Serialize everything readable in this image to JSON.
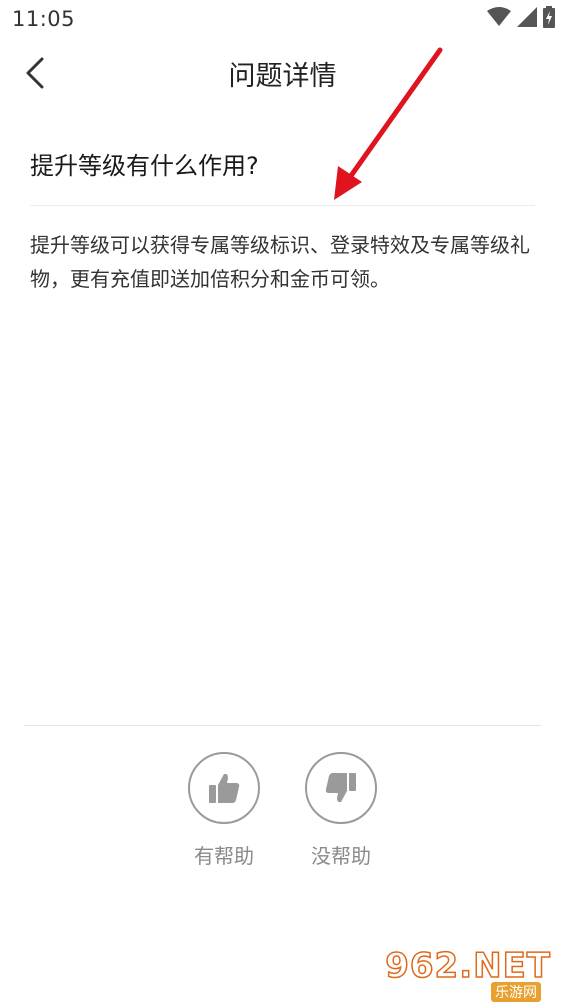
{
  "status_bar": {
    "time": "11:05"
  },
  "nav": {
    "title": "问题详情"
  },
  "question": {
    "title": "提升等级有什么作用?"
  },
  "answer": {
    "text": "提升等级可以获得专属等级标识、登录特效及专属等级礼物，更有充值即送加倍积分和金币可领。"
  },
  "feedback": {
    "helpful_label": "有帮助",
    "unhelpful_label": "没帮助"
  },
  "watermark": {
    "main": "962.NET",
    "sub": "乐游网"
  },
  "colors": {
    "annotation_arrow": "#e0141e",
    "icon_gray": "#9a9a9a",
    "label_gray": "#8a8a8a"
  }
}
